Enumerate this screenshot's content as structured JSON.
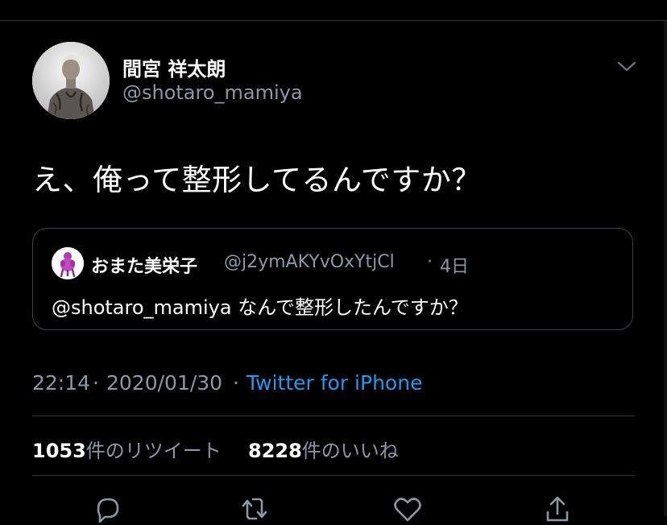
{
  "tweet": {
    "author": {
      "display_name": "間宮 祥太朗",
      "handle": "@shotaro_mamiya",
      "avatar": "profile-photo"
    },
    "text": "え、俺って整形してるんですか？",
    "menu_icon": "chevron-down-icon"
  },
  "quoted_tweet": {
    "author": {
      "display_name": "おまた美栄子",
      "handle": "@j2ymAKYvOxYtjCl",
      "avatar": "profile-photo"
    },
    "separator": "·",
    "time": "4日",
    "text": "@shotaro_mamiya なんで整形したんですか？"
  },
  "meta": {
    "time": "22:14",
    "separator": "·",
    "date": "2020/01/30",
    "source": "Twitter for iPhone"
  },
  "stats": {
    "retweets": {
      "count": "1053",
      "label": "件のリツイート"
    },
    "likes": {
      "count": "8228",
      "label": "件のいいね"
    }
  },
  "actions": [
    "reply-icon",
    "retweet-icon",
    "like-icon",
    "share-icon"
  ],
  "colors": {
    "background": "#000000",
    "text_primary": "#ffffff",
    "text_secondary": "#8b98a5",
    "link": "#1d9bf0",
    "border": "#38444d",
    "divider": "#2f3336"
  }
}
